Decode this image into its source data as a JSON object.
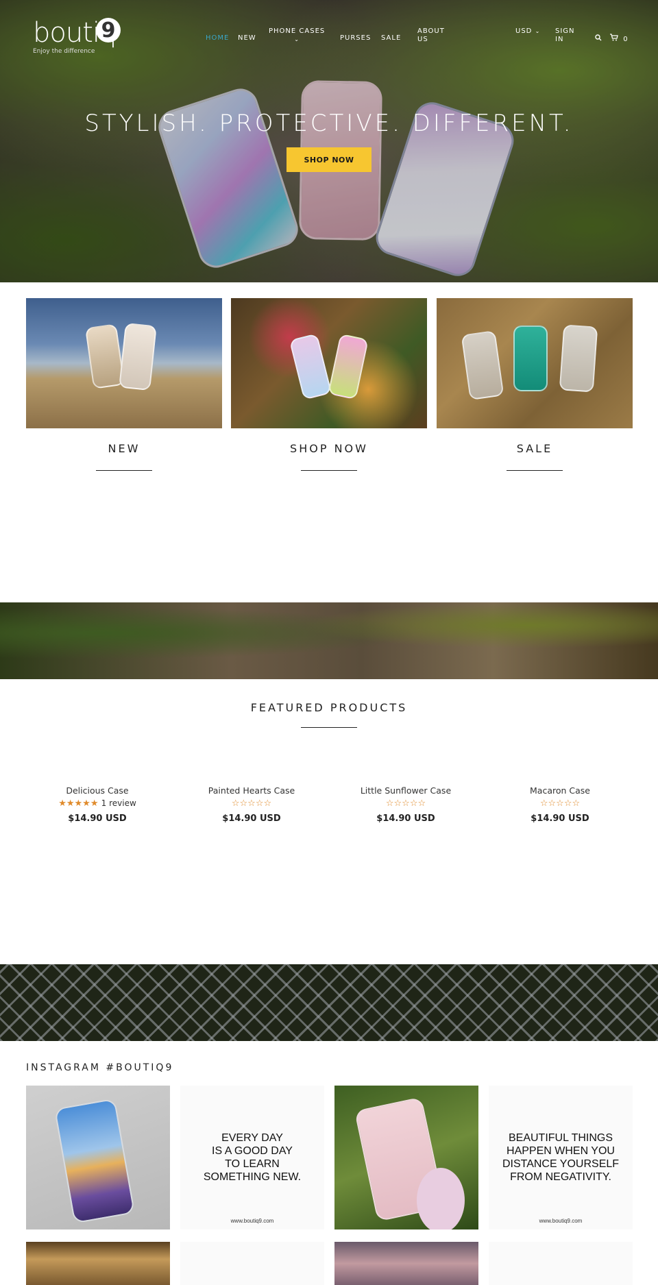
{
  "header": {
    "logo_text": "boutiq",
    "logo_mark": "9",
    "tagline": "Enjoy the difference",
    "nav": [
      {
        "label": "Home",
        "active": true
      },
      {
        "label": "New"
      },
      {
        "label": "Phone Cases"
      },
      {
        "label": "Purses"
      },
      {
        "label": "Sale"
      },
      {
        "label": "About Us"
      }
    ],
    "currency": "USD",
    "sign_in": "Sign In",
    "cart_count": "0"
  },
  "hero": {
    "title": "STYLISH. PROTECTIVE. DIFFERENT.",
    "button": "SHOP NOW",
    "accent": "#f7c630"
  },
  "categories": [
    {
      "title": "NEW"
    },
    {
      "title": "SHOP NOW"
    },
    {
      "title": "SALE"
    }
  ],
  "featured": {
    "title": "FEATURED PRODUCTS",
    "products": [
      {
        "name": "Delicious Case",
        "stars": "★★★★★",
        "reviews": "1 review",
        "price": "$14.90 USD"
      },
      {
        "name": "Painted Hearts Case",
        "stars": "☆☆☆☆☆",
        "reviews": "",
        "price": "$14.90 USD"
      },
      {
        "name": "Little Sunflower Case",
        "stars": "☆☆☆☆☆",
        "reviews": "",
        "price": "$14.90 USD"
      },
      {
        "name": "Macaron Case",
        "stars": "☆☆☆☆☆",
        "reviews": "",
        "price": "$14.90 USD"
      }
    ]
  },
  "instagram": {
    "title": "INSTAGRAM #BOUTIQ9",
    "quotes": [
      {
        "text": "EVERY DAY\nIS A GOOD DAY\nTO LEARN\nSOMETHING NEW.",
        "url": "www.boutiq9.com"
      },
      {
        "text": "BEAUTIFUL THINGS\nHAPPEN WHEN YOU\nDISTANCE YOURSELF\nFROM NEGATIVITY.",
        "url": "www.boutiq9.com"
      }
    ]
  },
  "icons": {
    "search": "search-icon",
    "cart": "cart-icon",
    "caret": "chevron-down-icon",
    "star": "star-icon"
  }
}
